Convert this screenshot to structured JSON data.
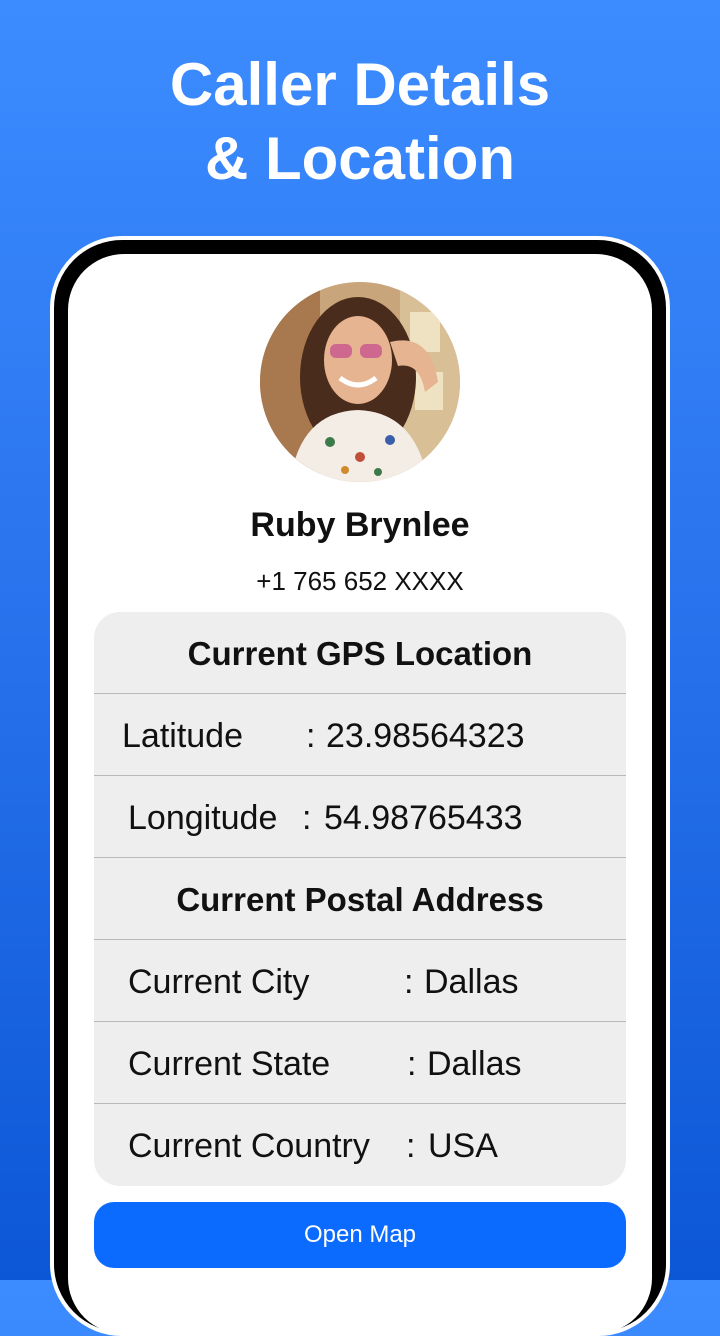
{
  "headline": {
    "line1": "Caller Details",
    "line2": "& Location"
  },
  "caller": {
    "name": "Ruby Brynlee",
    "phone": "+1 765 652 XXXX"
  },
  "gps": {
    "heading": "Current GPS Location",
    "latitude": {
      "label": "Latitude",
      "sep": ":",
      "value": "23.98564323"
    },
    "longitude": {
      "label": "Longitude",
      "sep": ":",
      "value": "54.98765433"
    }
  },
  "postal": {
    "heading": "Current Postal Address",
    "city": {
      "label": "Current City",
      "sep": ":",
      "value": "Dallas"
    },
    "state": {
      "label": "Current State",
      "sep": ":",
      "value": "Dallas"
    },
    "country": {
      "label": "Current Country",
      "sep": ":",
      "value": "USA"
    }
  },
  "actions": {
    "open_map": "Open Map"
  },
  "colors": {
    "background": "#2a74ee",
    "button": "#0b6bff",
    "card": "#eeeeee"
  }
}
